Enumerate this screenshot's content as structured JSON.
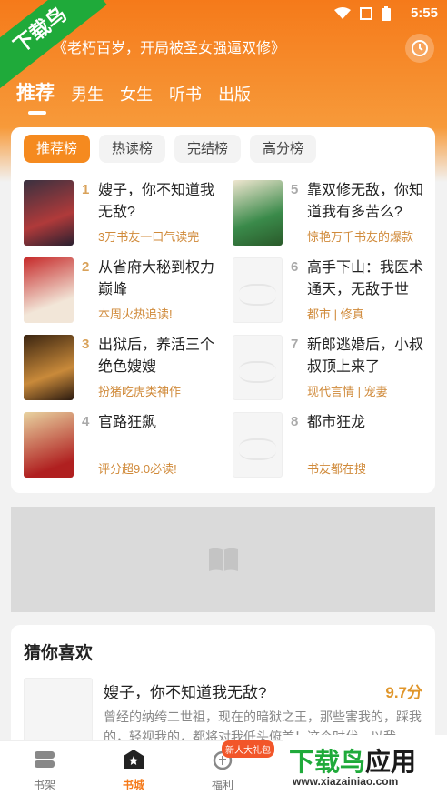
{
  "status": {
    "time": "5:55"
  },
  "watermark": {
    "corner": "下载鸟",
    "bottom_text_a": "下载鸟",
    "bottom_text_b": "应用",
    "url": "www.xiazainiao.com"
  },
  "search": {
    "text": "《老朽百岁，开局被圣女强逼双修》"
  },
  "tabs": [
    {
      "label": "推荐",
      "active": true
    },
    {
      "label": "男生"
    },
    {
      "label": "女生"
    },
    {
      "label": "听书"
    },
    {
      "label": "出版"
    }
  ],
  "rank_tabs": [
    {
      "label": "推荐榜",
      "active": true
    },
    {
      "label": "热读榜"
    },
    {
      "label": "完结榜"
    },
    {
      "label": "高分榜"
    }
  ],
  "books": [
    {
      "rank": "1",
      "title": "嫂子，你不知道我无敌?",
      "sub": "3万书友一口气读完"
    },
    {
      "rank": "2",
      "title": "从省府大秘到权力巅峰",
      "sub": "本周火热追读!"
    },
    {
      "rank": "3",
      "title": "出狱后，养活三个绝色嫂嫂",
      "sub": "扮猪吃虎类神作"
    },
    {
      "rank": "4",
      "title": "官路狂飙",
      "sub": "评分超9.0必读!"
    },
    {
      "rank": "5",
      "title": "靠双修无敌，你知道我有多苦么?",
      "sub": "惊艳万千书友的爆款"
    },
    {
      "rank": "6",
      "title": "高手下山：我医术通天，无敌于世",
      "sub": "都市 | 修真"
    },
    {
      "rank": "7",
      "title": "新郎逃婚后，小叔叔顶上来了",
      "sub": "现代言情 | 宠妻"
    },
    {
      "rank": "8",
      "title": "都市狂龙",
      "sub": "书友都在搜"
    }
  ],
  "guess": {
    "title": "猜你喜欢",
    "book_title": "嫂子，你不知道我无敌?",
    "score": "9.7分",
    "desc": "曾经的纳绔二世祖，现在的暗狱之王，那些害我的，踩我的，轻视我的，都将对我低头俯首！这个时代，以我"
  },
  "nav": [
    {
      "label": "书架"
    },
    {
      "label": "书城",
      "active": true
    },
    {
      "label": "福利",
      "badge": "新人大礼包"
    }
  ],
  "colors": {
    "accent": "#f57a1a",
    "gold": "#d9a25a"
  }
}
